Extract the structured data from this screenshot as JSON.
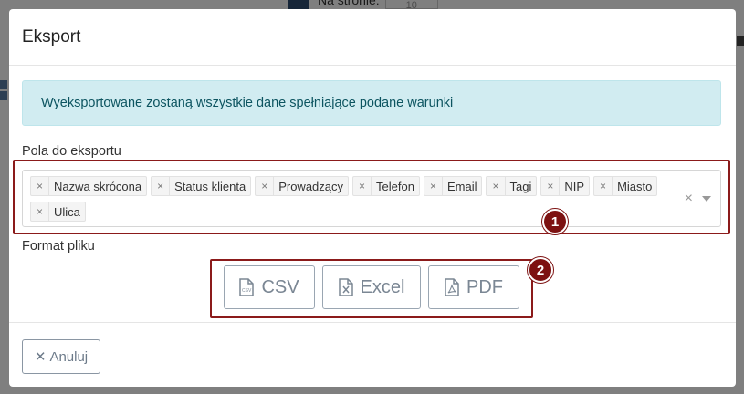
{
  "background": {
    "page_label": "Na stronie:",
    "page_value": "10"
  },
  "modal": {
    "title": "Eksport",
    "alert_text": "Wyeksportowane zostaną wszystkie dane spełniające podane warunki",
    "fields_label": "Pola do eksportu",
    "selected_fields": [
      "Nazwa skrócona",
      "Status klienta",
      "Prowadzący",
      "Telefon",
      "Email",
      "Tagi",
      "NIP",
      "Miasto",
      "Ulica"
    ],
    "tag_remove_glyph": "×",
    "clear_glyph": "×",
    "format_label": "Format pliku",
    "formats": {
      "csv": {
        "label": "CSV",
        "icon": "file-csv-icon"
      },
      "excel": {
        "label": "Excel",
        "icon": "file-excel-icon"
      },
      "pdf": {
        "label": "PDF",
        "icon": "file-pdf-icon"
      }
    },
    "cancel_label": "Anuluj",
    "cancel_glyph": "✕"
  },
  "annotations": {
    "badge1": "1",
    "badge2": "2"
  },
  "colors": {
    "alert_bg": "#d1ecf1",
    "alert_text": "#0c5460",
    "highlight": "#8b1a1a",
    "badge": "#7d1111",
    "button_text": "#7b8794"
  }
}
